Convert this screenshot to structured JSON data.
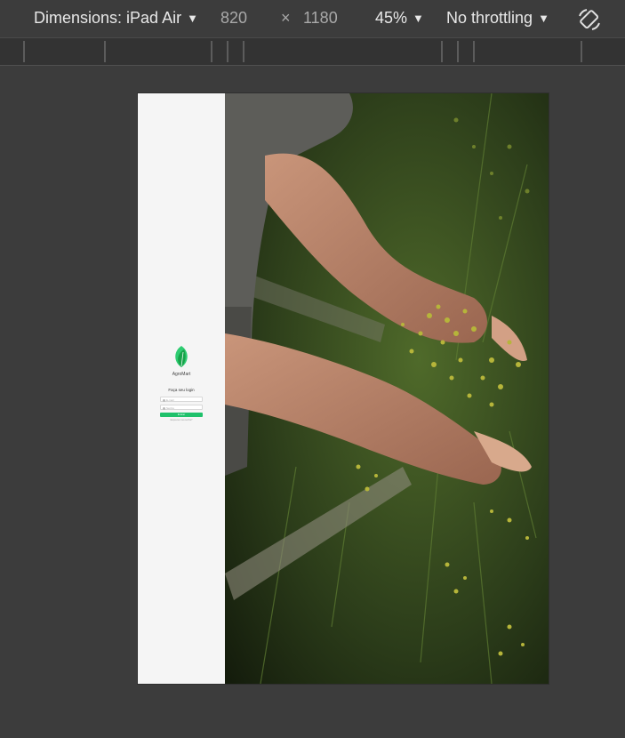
{
  "toolbar": {
    "dimensions_label": "Dimensions: iPad Air",
    "width_value": "820",
    "times_symbol": "×",
    "height_value": "1180",
    "zoom": "45%",
    "throttling": "No throttling",
    "rotate_icon": "rotate-icon",
    "dropdown_icon": "chevron-down-icon"
  },
  "device_page": {
    "brand_name": "AgroMart",
    "login_title": "Faça seu login",
    "email_placeholder": "E-mail",
    "password_placeholder": "Senha",
    "submit_label": "Entrar",
    "forgot_link": "Esqueceu sua senha?",
    "accent_color": "#1fc16b",
    "photo_description_icon": "hero-photo"
  }
}
